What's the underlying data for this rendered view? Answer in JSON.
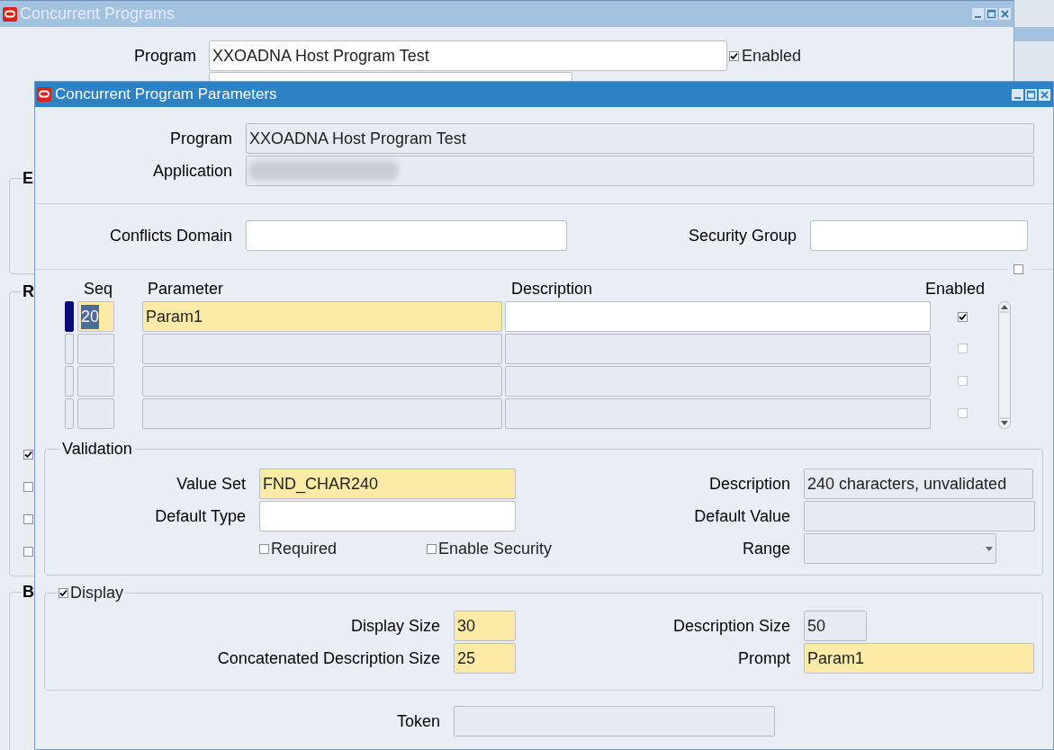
{
  "background_window": {
    "title": "Concurrent Programs",
    "program": {
      "label": "Program",
      "value": "XXOADNA Host Program Test",
      "kind": "editable"
    },
    "enabled": {
      "label": "Enabled",
      "checked": true
    },
    "groups": [
      {
        "label": "E"
      },
      {
        "label": "R",
        "checkboxes": [
          {
            "checked": true
          },
          {
            "checked": false
          },
          {
            "checked": false
          },
          {
            "checked": false
          }
        ]
      },
      {
        "label": "B"
      }
    ]
  },
  "dialog": {
    "title": "Concurrent Program Parameters",
    "program": {
      "label": "Program",
      "value": "XXOADNA Host Program Test",
      "kind": "readonly"
    },
    "application": {
      "label": "Application",
      "kind": "readonly",
      "redacted": true
    },
    "conflicts_domain": {
      "label": "Conflicts Domain",
      "kind": "editable"
    },
    "security_group": {
      "label": "Security Group",
      "kind": "editable"
    },
    "record_checkbox": {
      "checked": false
    },
    "parameters": {
      "columns": [
        "Seq",
        "Parameter",
        "Description",
        "Enabled"
      ],
      "rows": [
        {
          "seq": "20",
          "parameter": "Param1",
          "current": true,
          "enabled": true
        },
        {
          "current": false,
          "enabled": false
        },
        {
          "current": false,
          "enabled": false
        },
        {
          "current": false,
          "enabled": false
        }
      ]
    },
    "validation": {
      "title": "Validation",
      "value_set": {
        "label": "Value Set",
        "value": "FND_CHAR240",
        "kind": "required"
      },
      "description": {
        "label": "Description",
        "value": "240 characters, unvalidated",
        "kind": "readonly"
      },
      "default_type": {
        "label": "Default Type",
        "kind": "editable"
      },
      "default_value": {
        "label": "Default Value",
        "kind": "readonly"
      },
      "required": {
        "label": "Required",
        "checked": false
      },
      "enable_security": {
        "label": "Enable Security",
        "checked": false
      },
      "range": {
        "label": "Range",
        "kind": "readonly"
      }
    },
    "display": {
      "label": "Display",
      "checked": true,
      "display_size": {
        "label": "Display Size",
        "value": "30",
        "kind": "required"
      },
      "description_size": {
        "label": "Description Size",
        "value": "50",
        "kind": "readonly"
      },
      "concatenated_description_size": {
        "label": "Concatenated Description Size",
        "value": "25",
        "kind": "required"
      },
      "prompt": {
        "label": "Prompt",
        "value": "Param1",
        "kind": "required"
      }
    },
    "token": {
      "label": "Token",
      "kind": "readonly"
    }
  }
}
